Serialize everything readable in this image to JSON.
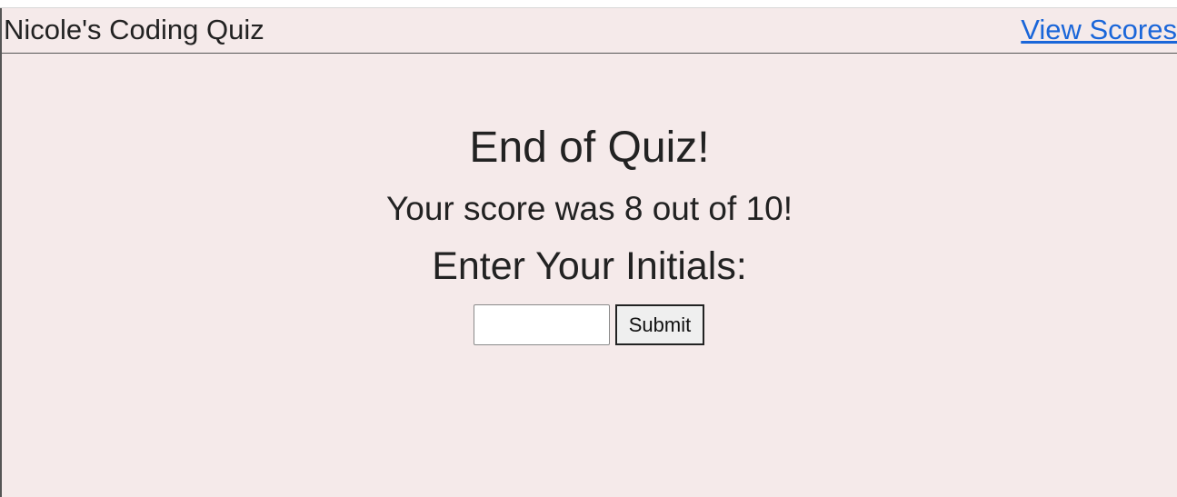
{
  "header": {
    "brand": "Nicole's Coding Quiz",
    "view_scores_link": "View Scores"
  },
  "main": {
    "title": "End of Quiz!",
    "score_text": "Your score was 8 out of 10!",
    "initials_prompt": "Enter Your Initials:",
    "initials_input": {
      "value": "",
      "placeholder": ""
    },
    "submit_label": "Submit"
  },
  "colors": {
    "page_background": "#f5eaea",
    "link": "#1a66d9",
    "text": "#222222"
  }
}
